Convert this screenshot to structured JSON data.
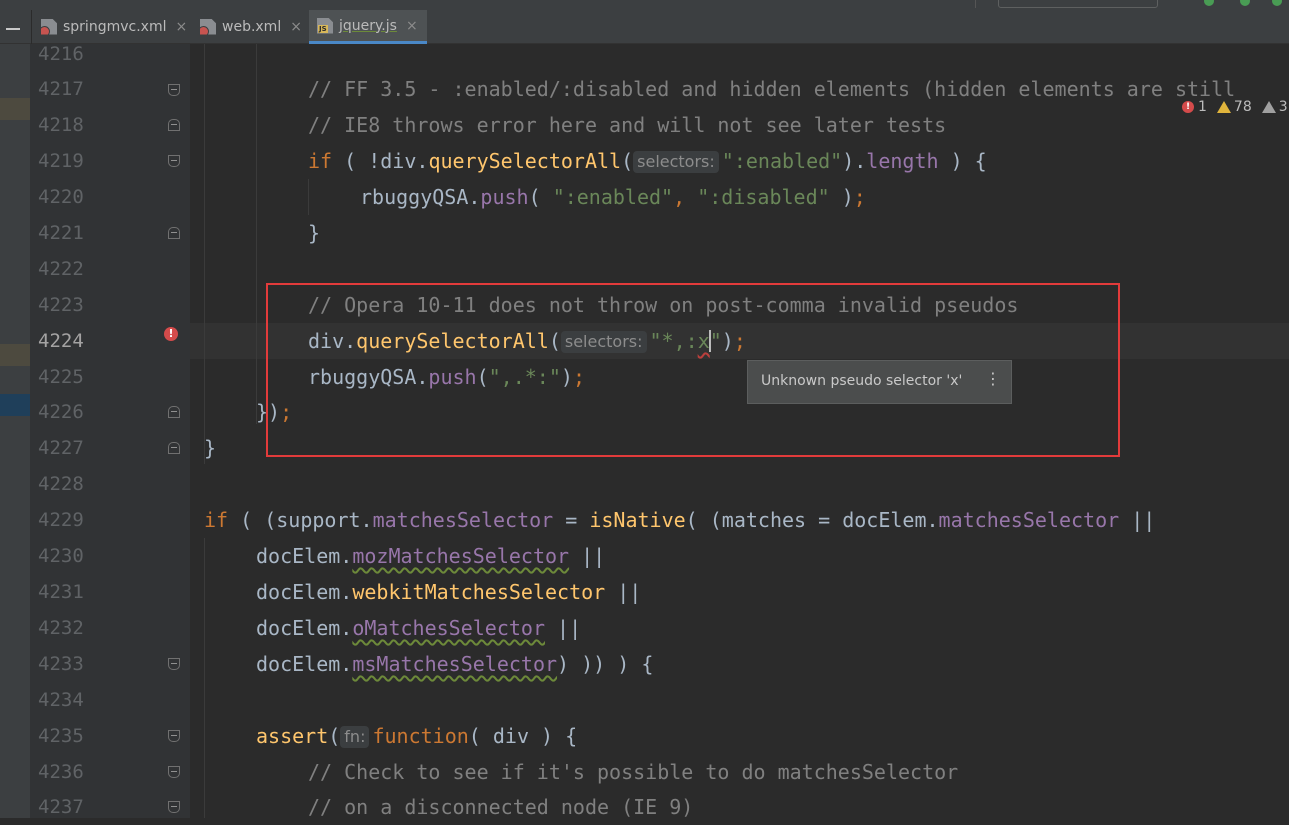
{
  "tabs": [
    {
      "label": "springmvc.xml",
      "icon": "xml-file-icon",
      "active": false
    },
    {
      "label": "web.xml",
      "icon": "xml-file-icon",
      "active": false
    },
    {
      "label": "jquery.js",
      "icon": "js-file-icon",
      "active": true
    }
  ],
  "js_badge": "JS",
  "close_glyph": "×",
  "indicators": {
    "errors": "1",
    "warnings": "78",
    "weak": "3",
    "error_glyph": "!"
  },
  "tooltip": {
    "message": "Unknown pseudo selector 'x'",
    "more": "⋮"
  },
  "error_marker": "!",
  "line_numbers": [
    "4216",
    "4217",
    "4218",
    "4219",
    "4220",
    "4221",
    "4222",
    "4223",
    "4224",
    "4225",
    "4226",
    "4227",
    "4228",
    "4229",
    "4230",
    "4231",
    "4232",
    "4233",
    "4234",
    "4235",
    "4236",
    "4237"
  ],
  "current_line": "4224",
  "code": {
    "c4217": "// FF 3.5 - :enabled/:disabled and hidden elements (hidden elements are still",
    "c4218": "// IE8 throws error here and will not see later tests",
    "if": "if",
    "paren_open_space": " ( ",
    "not_div": "!div.",
    "qsa": "querySelectorAll",
    "paren": "(",
    "hint_selectors": "selectors:",
    "str_enabled": "\":enabled\"",
    "close_dot": ").",
    "length": "length",
    "close_brace_open": " ) {",
    "rbuggy": "rbuggyQSA.",
    "push": "push",
    "push_open": "( ",
    "comma": ", ",
    "str_disabled": "\":disabled\"",
    "close_paren_space": " )",
    "semi": ";",
    "brace_close": "}",
    "c4223": "// Opera 10-11 does not throw on post-comma invalid pseudos",
    "div_dot": "div.",
    "str_star_pre": "\"*,:",
    "str_x": "x",
    "str_quote": "\"",
    "close_paren": ")",
    "str_comma_star": "\",.*:\"",
    "brace_paren_close": "})",
    "support_open": " ( (support.",
    "matchesSelector": "matchesSelector",
    "assign": " = ",
    "isNative": "isNative",
    "matches_assign": "( (matches = docElem.",
    "or": " ||",
    "docElem": "docElem.",
    "moz": "mozMatchesSelector",
    "webkit": "webkitMatchesSelector",
    "o": "oMatchesSelector",
    "ms": "msMatchesSelector",
    "ms_close": ") )) ) {",
    "assert": "assert",
    "hint_fn": "fn:",
    "function": "function",
    "div_param": "( div ) {",
    "c4236": "// Check to see if it's possible to do matchesSelector",
    "c4237": "// on a disconnected node (IE 9)"
  },
  "colors": {
    "background": "#2b2b2b",
    "gutter": "#313335",
    "keyword": "#cc7832",
    "function": "#ffc66d",
    "property": "#9876aa",
    "string": "#6a8759",
    "comment": "#808080",
    "highlight_box": "#e23b3b"
  }
}
